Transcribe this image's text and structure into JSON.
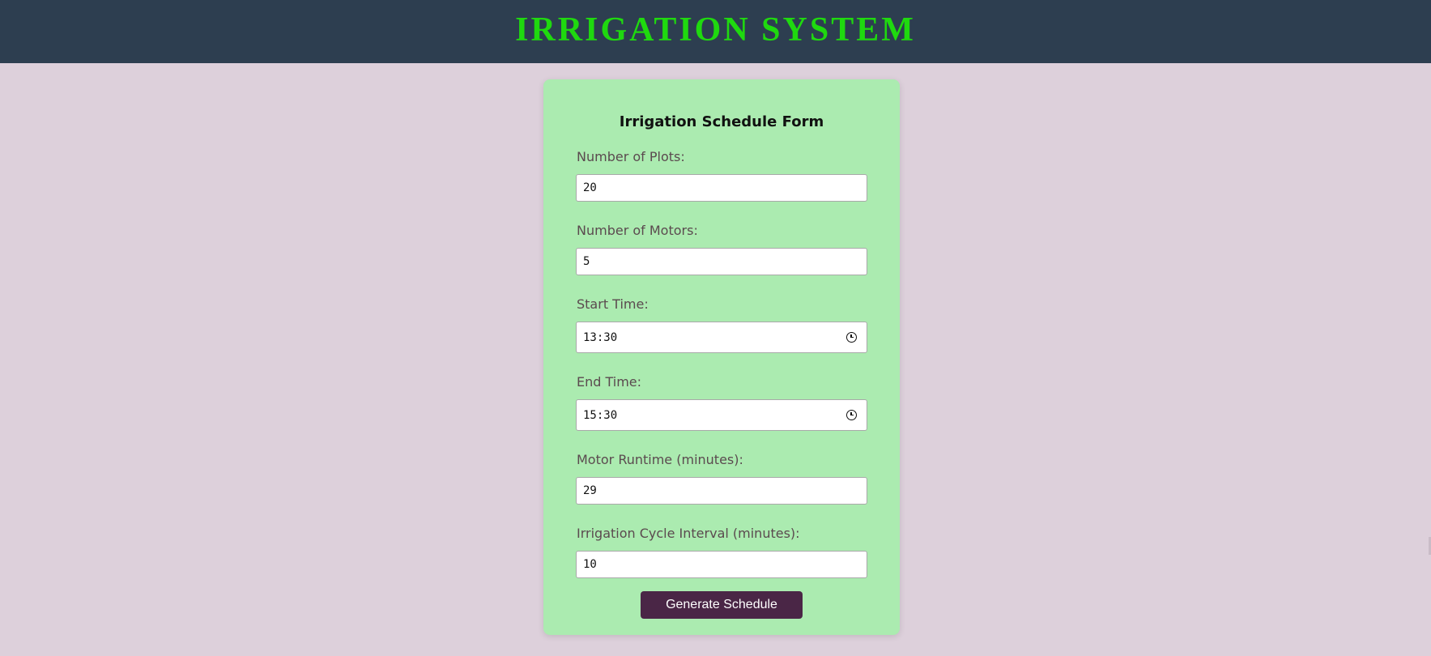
{
  "header": {
    "title": "IRRIGATION SYSTEM"
  },
  "form": {
    "title": "Irrigation Schedule Form",
    "fields": [
      {
        "label": "Number of Plots:",
        "value": "20"
      },
      {
        "label": "Number of Motors:",
        "value": "5"
      },
      {
        "label": "Start Time:",
        "value": "13:30",
        "icon": "clock-icon"
      },
      {
        "label": "End Time:",
        "value": "15:30",
        "icon": "clock-icon"
      },
      {
        "label": "Motor Runtime (minutes):",
        "value": "29"
      },
      {
        "label": "Irrigation Cycle Interval (minutes):",
        "value": "10"
      }
    ],
    "submit_label": "Generate Schedule"
  },
  "colors": {
    "header_bg": "#2d3e50",
    "title": "#1fd90f",
    "page_bg": "#ddd0db",
    "card_bg": "#abebb0",
    "button_bg": "#4a2646"
  }
}
